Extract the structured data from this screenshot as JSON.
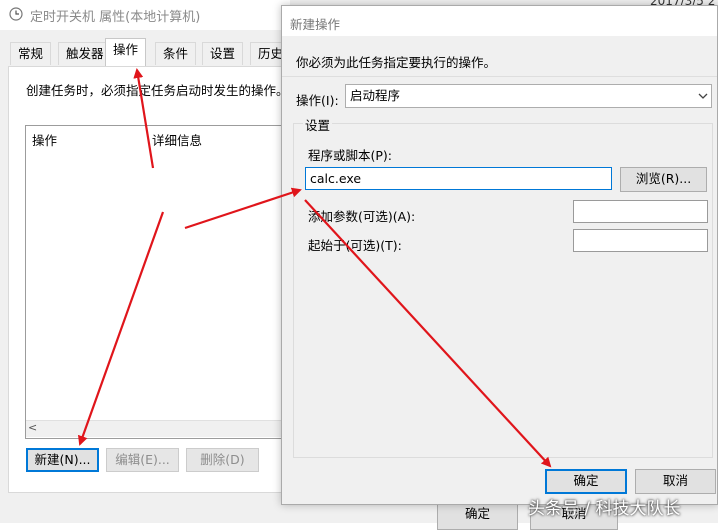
{
  "background_window": {
    "title": "定时开关机 属性(本地计算机)",
    "date_fragment": "2017/3/5 2",
    "tabs": [
      "常规",
      "触发器",
      "操作",
      "条件",
      "设置",
      "历史"
    ],
    "active_tab": "操作",
    "description": "创建任务时，必须指定任务启动时发生的操作。",
    "columns": [
      "操作",
      "详细信息"
    ],
    "buttons": {
      "new": "新建(N)...",
      "edit": "编辑(E)...",
      "delete": "删除(D)"
    },
    "footer": {
      "ok": "确定",
      "cancel": "取消"
    },
    "scroll_left_glyph": "<"
  },
  "dialog": {
    "title": "新建操作",
    "instruction": "你必须为此任务指定要执行的操作。",
    "operation_label": "操作(I):",
    "operation_value": "启动程序",
    "settings_label": "设置",
    "program_label": "程序或脚本(P):",
    "program_value": "calc.exe",
    "browse": "浏览(R)...",
    "args_label": "添加参数(可选)(A):",
    "start_label": "起始于(可选)(T):",
    "ok": "确定",
    "cancel": "取消"
  },
  "watermark": "头条号 / 科技大队长",
  "colors": {
    "annotation_arrow": "#e0151b",
    "focus": "#0078d7"
  },
  "icons": {
    "title": "clock-icon",
    "dropdown": "chevron-down-icon"
  }
}
